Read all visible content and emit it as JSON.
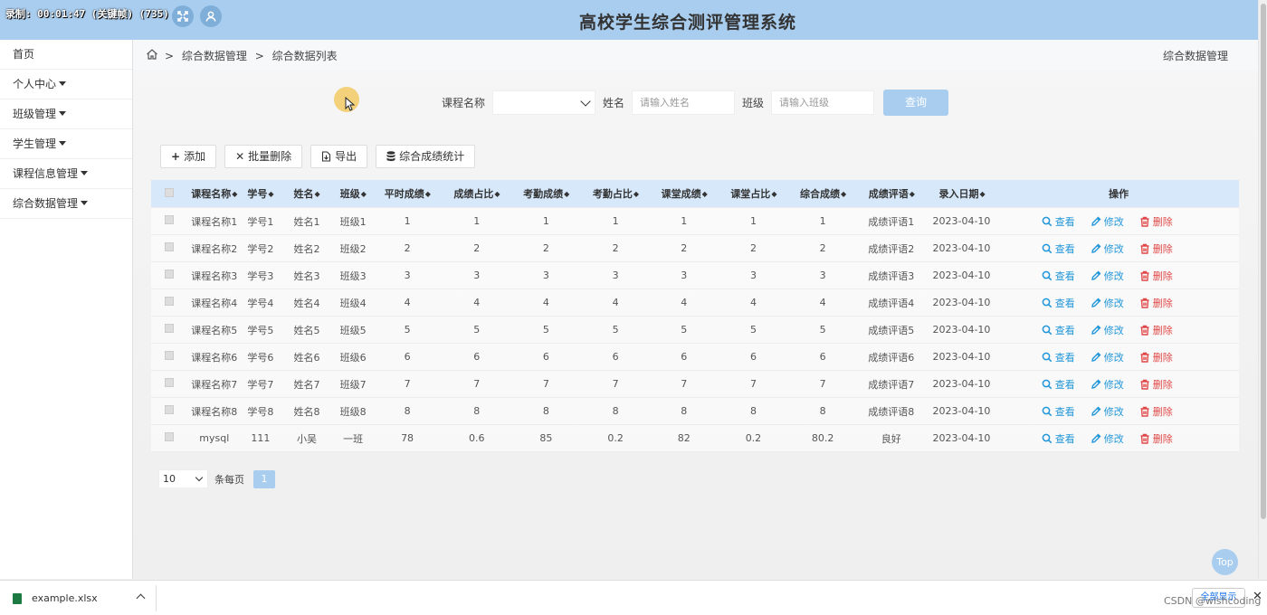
{
  "timer": "录制: 00:01:47 (关键帧) (735)",
  "header": {
    "title": "高校学生综合测评管理系统",
    "fullscreen_icon": "expand-icon",
    "user_icon": "user-icon"
  },
  "sidebar": {
    "items": [
      {
        "label": "首页",
        "dropdown": false
      },
      {
        "label": "个人中心",
        "dropdown": true
      },
      {
        "label": "班级管理",
        "dropdown": true
      },
      {
        "label": "学生管理",
        "dropdown": true
      },
      {
        "label": "课程信息管理",
        "dropdown": true
      },
      {
        "label": "综合数据管理",
        "dropdown": true
      }
    ]
  },
  "breadcrumb": {
    "sep": ">",
    "items": [
      "综合数据管理",
      "综合数据列表"
    ],
    "right": "综合数据管理"
  },
  "search": {
    "course_label": "课程名称",
    "course_value": "",
    "name_label": "姓名",
    "name_placeholder": "请输入姓名",
    "class_label": "班级",
    "class_placeholder": "请输入班级",
    "button": "查询"
  },
  "toolbar": {
    "add": "添加",
    "batch_delete": "批量删除",
    "export": "导出",
    "stats": "综合成绩统计"
  },
  "table": {
    "headers": [
      "课程名称",
      "学号",
      "姓名",
      "班级",
      "平时成绩",
      "成绩占比",
      "考勤成绩",
      "考勤占比",
      "课堂成绩",
      "课堂占比",
      "综合成绩",
      "成绩评语",
      "录入日期",
      "操作"
    ],
    "sort_glyph": "◆",
    "actions": {
      "view": "查看",
      "edit": "修改",
      "delete": "删除"
    },
    "rows": [
      [
        "课程名称1",
        "学号1",
        "姓名1",
        "班级1",
        "1",
        "1",
        "1",
        "1",
        "1",
        "1",
        "1",
        "成绩评语1",
        "2023-04-10"
      ],
      [
        "课程名称2",
        "学号2",
        "姓名2",
        "班级2",
        "2",
        "2",
        "2",
        "2",
        "2",
        "2",
        "2",
        "成绩评语2",
        "2023-04-10"
      ],
      [
        "课程名称3",
        "学号3",
        "姓名3",
        "班级3",
        "3",
        "3",
        "3",
        "3",
        "3",
        "3",
        "3",
        "成绩评语3",
        "2023-04-10"
      ],
      [
        "课程名称4",
        "学号4",
        "姓名4",
        "班级4",
        "4",
        "4",
        "4",
        "4",
        "4",
        "4",
        "4",
        "成绩评语4",
        "2023-04-10"
      ],
      [
        "课程名称5",
        "学号5",
        "姓名5",
        "班级5",
        "5",
        "5",
        "5",
        "5",
        "5",
        "5",
        "5",
        "成绩评语5",
        "2023-04-10"
      ],
      [
        "课程名称6",
        "学号6",
        "姓名6",
        "班级6",
        "6",
        "6",
        "6",
        "6",
        "6",
        "6",
        "6",
        "成绩评语6",
        "2023-04-10"
      ],
      [
        "课程名称7",
        "学号7",
        "姓名7",
        "班级7",
        "7",
        "7",
        "7",
        "7",
        "7",
        "7",
        "7",
        "成绩评语7",
        "2023-04-10"
      ],
      [
        "课程名称8",
        "学号8",
        "姓名8",
        "班级8",
        "8",
        "8",
        "8",
        "8",
        "8",
        "8",
        "8",
        "成绩评语8",
        "2023-04-10"
      ],
      [
        "mysql",
        "111",
        "小吴",
        "一班",
        "78",
        "0.6",
        "85",
        "0.2",
        "82",
        "0.2",
        "80.2",
        "良好",
        "2023-04-10"
      ]
    ]
  },
  "pagination": {
    "page_size": "10",
    "per_page_label": "条每页",
    "current_page": "1"
  },
  "top_button": "Top",
  "download_bar": {
    "file": "example.xlsx",
    "show_all": "全部显示",
    "close": "✕"
  },
  "watermark": "CSDN @wishcoding"
}
